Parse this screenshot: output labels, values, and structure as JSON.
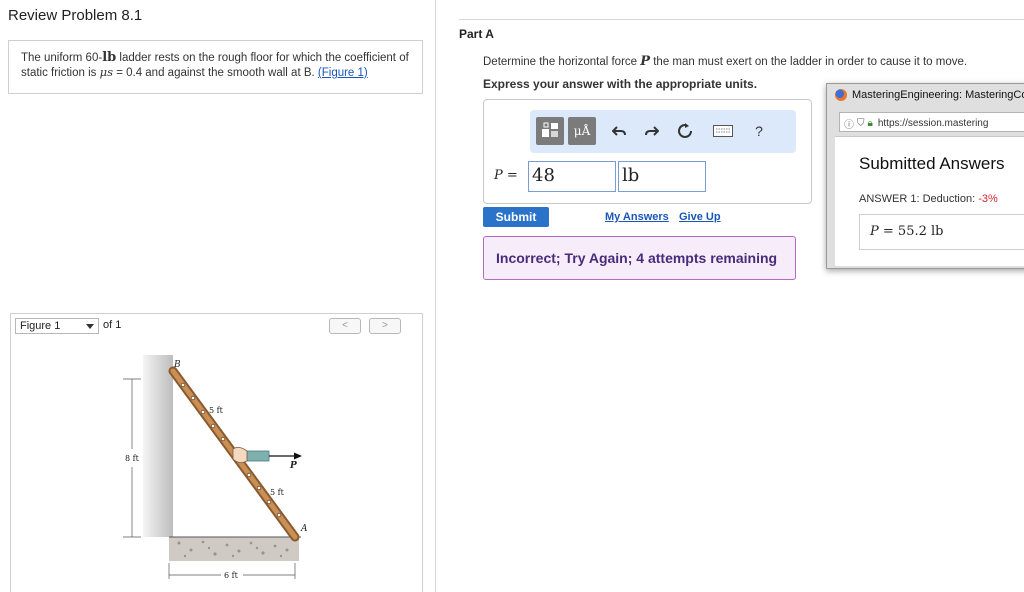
{
  "review": {
    "title": "Review Problem 8.1",
    "problem_pre": "The uniform 60-",
    "problem_lb": "lb",
    "problem_mid": " ladder rests on the rough floor for which the coefficient of static friction is ",
    "mu_symbol": "μs",
    "problem_post": " = 0.4 and against the smooth wall at B.",
    "figure_link": "(Figure 1)"
  },
  "figure": {
    "selected": "Figure 1",
    "of_text": "of 1",
    "prev": "<",
    "next": ">",
    "labels": {
      "b": "B",
      "a": "A",
      "p": "P",
      "height": "8 ft",
      "upper_seg": "5 ft",
      "lower_seg": "5 ft",
      "base": "6 ft"
    }
  },
  "part": {
    "title": "Part A",
    "question_pre": "Determine the horizontal force ",
    "question_var": "P",
    "question_post": " the man must exert on the ladder in order to cause it to move.",
    "instructions": "Express your answer with the appropriate units."
  },
  "answer": {
    "label_var": "P",
    "label_eq": " =",
    "value": "48",
    "unit": "lb",
    "toolbar": {
      "mu_label": "μÅ",
      "help_label": "?"
    }
  },
  "actions": {
    "submit": "Submit",
    "my_answers": "My Answers",
    "give_up": "Give Up"
  },
  "feedback": {
    "text": "Incorrect; Try Again; 4 attempts remaining"
  },
  "popup": {
    "title": "MasteringEngineering: MasteringCo",
    "url": "https://session.mastering",
    "heading": "Submitted Answers",
    "deduction_label": "ANSWER 1: Deduction: ",
    "deduction_value": "-3%",
    "answer_var": "P",
    "answer_eq": " =  ",
    "answer_value": "55.2 lb"
  },
  "colors": {
    "submit_bg": "#2b73c9",
    "feedback_border": "#b06ac7",
    "feedback_bg": "#f7ecfa",
    "toolbar_bg": "#dbe9fb",
    "deduction_red": "#d1262d",
    "link": "#1a56b8"
  }
}
